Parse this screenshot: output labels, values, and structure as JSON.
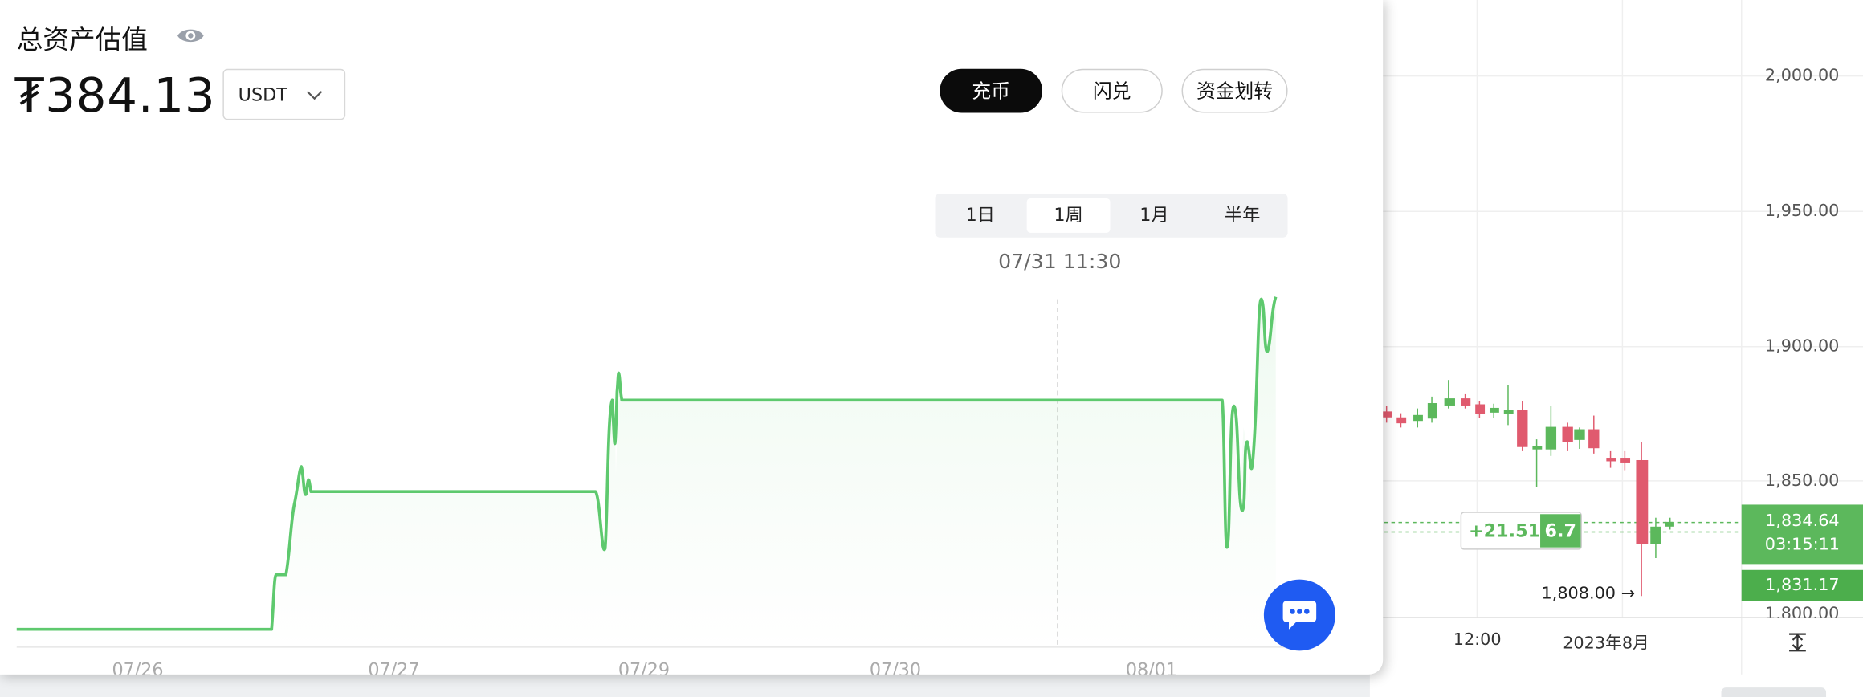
{
  "panel": {
    "title": "总资产估值",
    "amount": "₮384.13",
    "currency": "USDT",
    "buttons": {
      "deposit": "充币",
      "swap": "闪兑",
      "transfer": "资金划转"
    },
    "ranges": [
      "1日",
      "1周",
      "1月",
      "半年"
    ],
    "active_range": "1周",
    "hover_time": "07/31 11:30",
    "x_labels": [
      "07/26",
      "07/27",
      "07/29",
      "07/30",
      "08/01"
    ],
    "accent_color": "#5ec96e"
  },
  "bg_chart": {
    "y_ticks": [
      "2,000.00",
      "1,950.00",
      "1,900.00",
      "1,850.00",
      "1,800.00"
    ],
    "x_ticks": [
      "12:00",
      "2023年8月"
    ],
    "change_label": "+21.51",
    "change_value": "6.7",
    "current_price": "1,834.64",
    "countdown": "03:15:11",
    "second_price": "1,831.17",
    "low_marker": "1,808.00 →",
    "up_color": "#5cb85c",
    "down_color": "#e05a6e"
  }
}
